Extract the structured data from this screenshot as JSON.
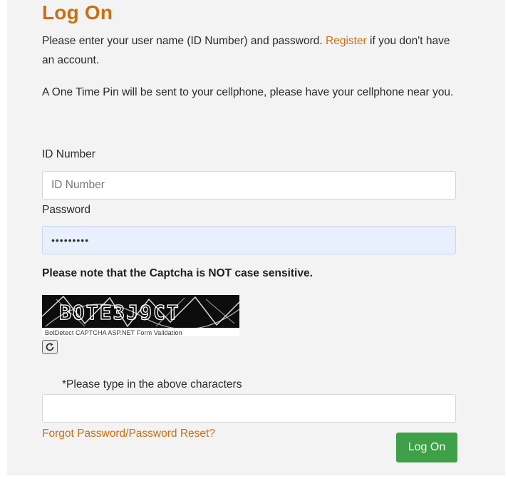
{
  "title": "Log On",
  "intro": {
    "before_link": "Please enter your user name (ID Number) and password. ",
    "register_link": "Register",
    "after_link": " if you don't have an account."
  },
  "otp_notice": "A One Time Pin will be sent to your cellphone, please have your cellphone near you.",
  "id_field": {
    "label": "ID Number",
    "placeholder": "ID Number",
    "value": ""
  },
  "password_field": {
    "label": "Password",
    "value": "•••••••••"
  },
  "captcha": {
    "note": "Please note that the Captcha is NOT case sensitive.",
    "image_text": "BOTE3J9CT",
    "caption": "BotDetect CAPTCHA ASP.NET Form Validation",
    "reload_icon": "reload-icon",
    "input_label": "*Please type in the above characters",
    "input_value": ""
  },
  "forgot_link": "Forgot Password/Password Reset?",
  "logon_button": "Log On",
  "colors": {
    "accent": "#c96f12",
    "button": "#3ea049",
    "panel": "#f3f3f3",
    "autofill": "#e8f0fe"
  }
}
